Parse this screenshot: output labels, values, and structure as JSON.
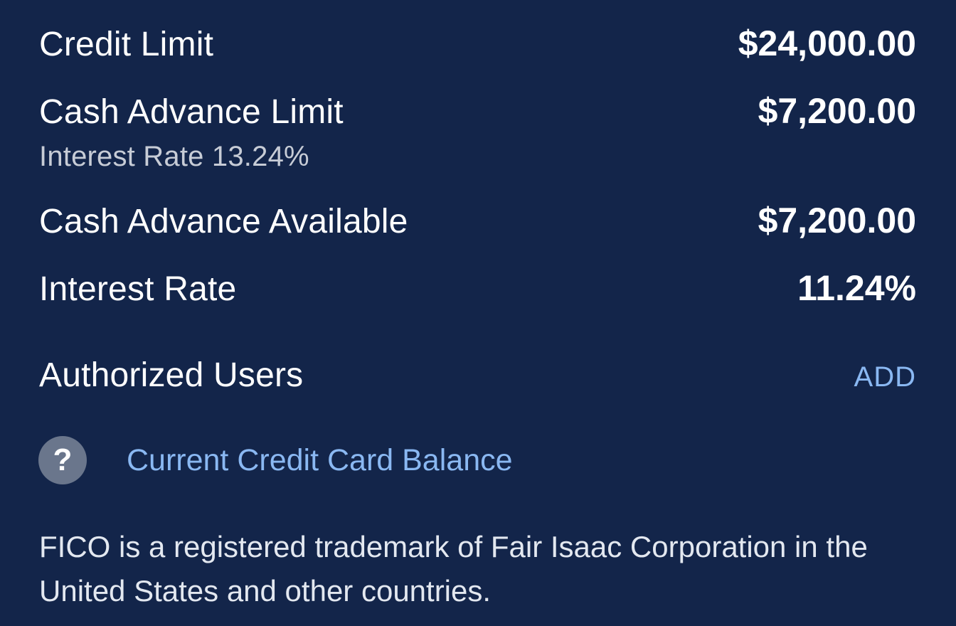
{
  "details": {
    "credit_limit": {
      "label": "Credit Limit",
      "value": "$24,000.00"
    },
    "cash_advance_limit": {
      "label": "Cash Advance Limit",
      "value": "$7,200.00",
      "sublabel": "Interest Rate 13.24%"
    },
    "cash_advance_available": {
      "label": "Cash Advance Available",
      "value": "$7,200.00"
    },
    "interest_rate": {
      "label": "Interest Rate",
      "value": "11.24%"
    }
  },
  "authorized_users": {
    "label": "Authorized Users",
    "action": "ADD"
  },
  "help": {
    "icon": "question-mark-icon",
    "icon_glyph": "?",
    "link": "Current Credit Card Balance"
  },
  "footnote": "FICO is a registered trademark of Fair Isaac Corporation in the United States and other countries.",
  "colors": {
    "background": "#13254a",
    "link": "#8ab8f2",
    "help_icon_bg": "#6a768c",
    "muted_text": "#c7ccd6"
  }
}
